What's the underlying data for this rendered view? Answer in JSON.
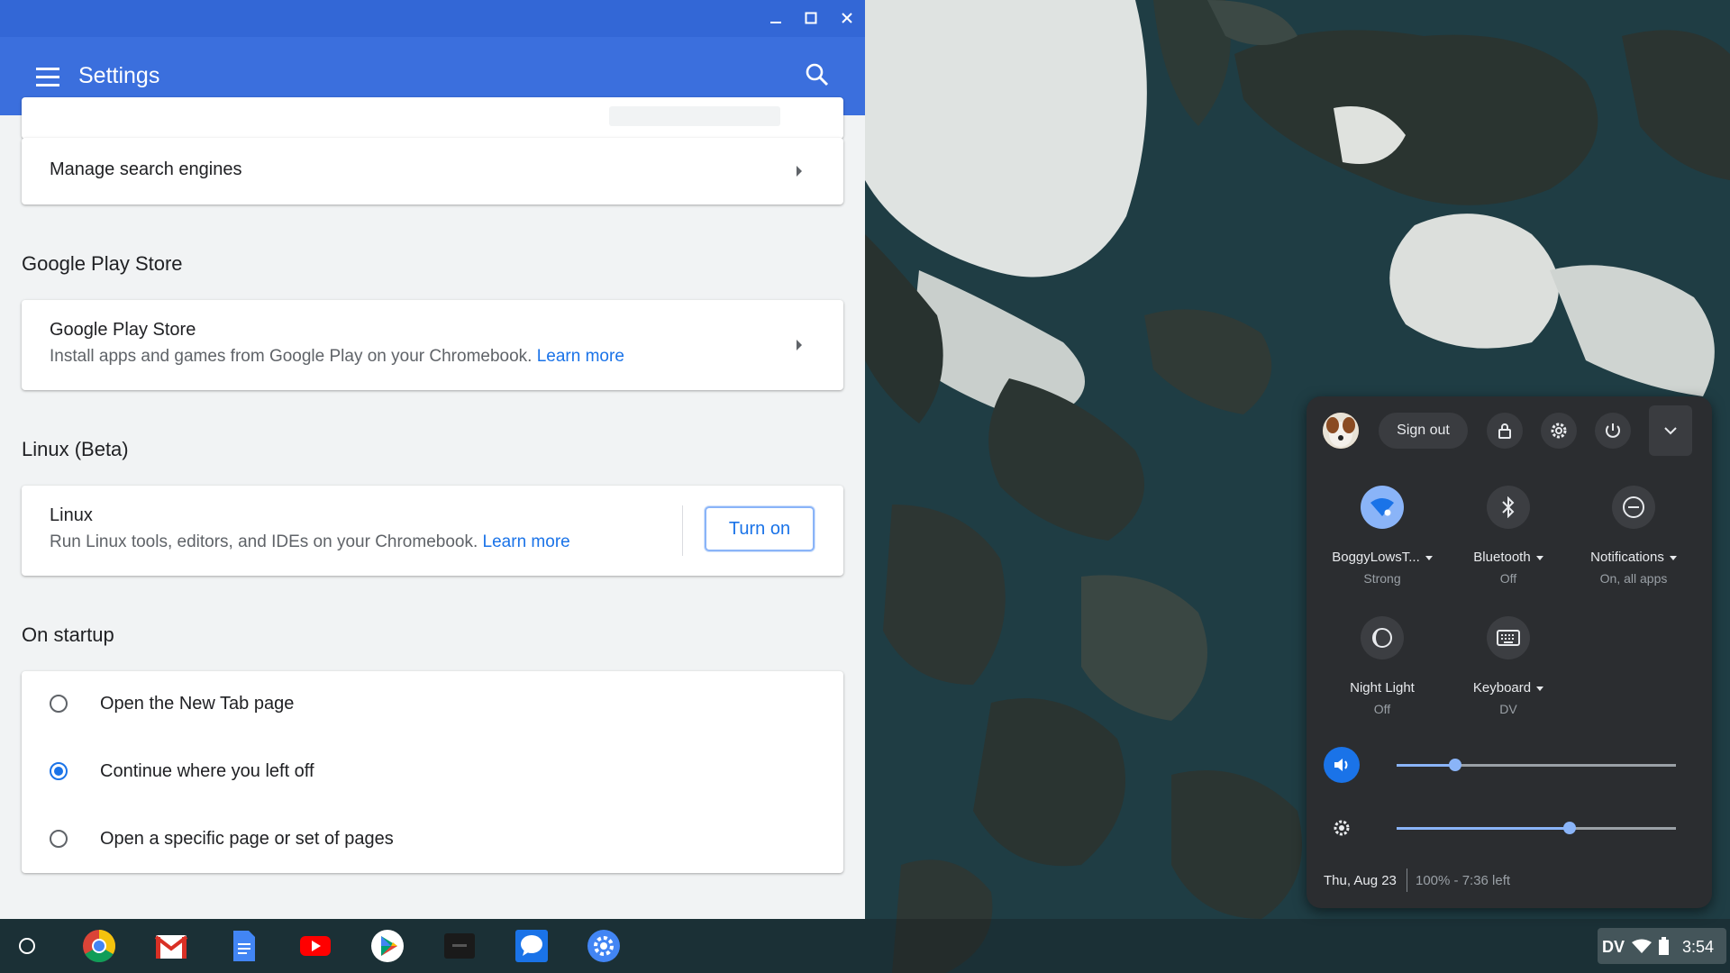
{
  "window": {
    "title": "Settings",
    "controls": [
      "minimize-icon",
      "maximize-icon",
      "close-icon"
    ]
  },
  "search_engines": {
    "manage_label": "Manage search engines"
  },
  "play_store": {
    "section_title": "Google Play Store",
    "title": "Google Play Store",
    "description": "Install apps and games from Google Play on your Chromebook.",
    "learn_more": "Learn more"
  },
  "linux": {
    "section_title": "Linux (Beta)",
    "title": "Linux",
    "description": "Run Linux tools, editors, and IDEs on your Chromebook.",
    "learn_more": "Learn more",
    "button": "Turn on"
  },
  "startup": {
    "section_title": "On startup",
    "options": [
      {
        "label": "Open the New Tab page",
        "selected": false
      },
      {
        "label": "Continue where you left off",
        "selected": true
      },
      {
        "label": "Open a specific page or set of pages",
        "selected": false
      }
    ]
  },
  "shelf": {
    "apps": [
      "launcher-icon",
      "chrome-icon",
      "gmail-icon",
      "docs-icon",
      "youtube-icon",
      "play-store-icon",
      "terminal-icon",
      "messages-icon",
      "settings-icon"
    ]
  },
  "status_area": {
    "ime": "DV",
    "time": "3:54"
  },
  "tray": {
    "sign_out": "Sign out",
    "features": [
      {
        "label": "BoggyLowsT...",
        "sub": "Strong",
        "icon": "wifi-icon",
        "active": true,
        "dropdown": true
      },
      {
        "label": "Bluetooth",
        "sub": "Off",
        "icon": "bluetooth-icon",
        "active": false,
        "dropdown": true
      },
      {
        "label": "Notifications",
        "sub": "On, all apps",
        "icon": "do-not-disturb-icon",
        "active": false,
        "dropdown": true
      },
      {
        "label": "Night Light",
        "sub": "Off",
        "icon": "night-light-icon",
        "active": false,
        "dropdown": false
      },
      {
        "label": "Keyboard",
        "sub": "DV",
        "icon": "keyboard-icon",
        "active": false,
        "dropdown": true
      }
    ],
    "volume_level": 0.21,
    "brightness_level": 0.62,
    "date": "Thu, Aug 23",
    "battery": "100% - 7:36 left"
  },
  "colors": {
    "appbar": "#3b6fdd",
    "titlebar": "#3367d6",
    "accent": "#1a73e8",
    "tray_bg": "#2b2d30",
    "tray_accent": "#8ab4f8"
  }
}
